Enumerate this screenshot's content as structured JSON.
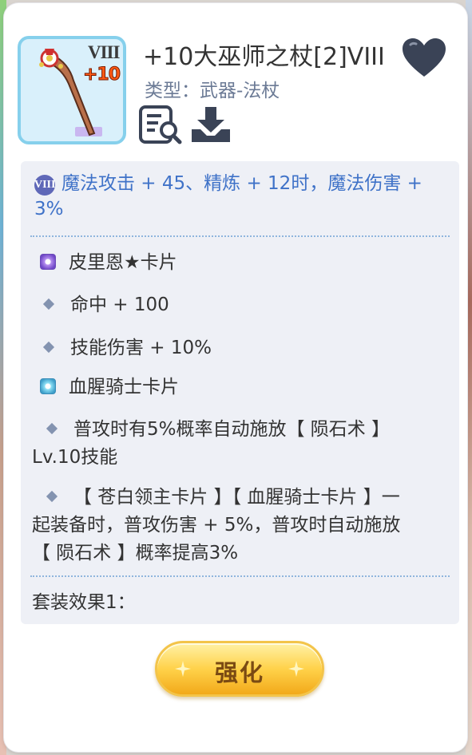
{
  "item": {
    "name": "+10大巫师之杖[2]VIII",
    "type_label": "类型：武器-法杖",
    "refine_badge": "VIII",
    "enhance_badge": "+10"
  },
  "refine_effect": {
    "badge": "VIII",
    "text": "魔法攻击 + 45、精炼 + 12时，魔法伤害 + 3%"
  },
  "cards": [
    {
      "name": "皮里恩★卡片",
      "icon": "purple-card-icon",
      "effects": [
        "命中 + 100",
        "技能伤害 + 10%"
      ]
    },
    {
      "name": "血腥骑士卡片",
      "icon": "blue-card-icon",
      "effects": [
        "普攻时有5%概率自动施放【 陨石术 】Lv.10技能",
        "【 苍白领主卡片 】【 血腥骑士卡片 】一起装备时，普攻伤害 + 5%，普攻时自动施放【 陨石术 】概率提高3%"
      ]
    }
  ],
  "set_effect": {
    "label": "套装效果1："
  },
  "actions": {
    "enhance_label": "强化"
  },
  "colors": {
    "accent_blue": "#3f72c8",
    "button_gold": "#ffd24a",
    "heart": "#3a4356"
  }
}
